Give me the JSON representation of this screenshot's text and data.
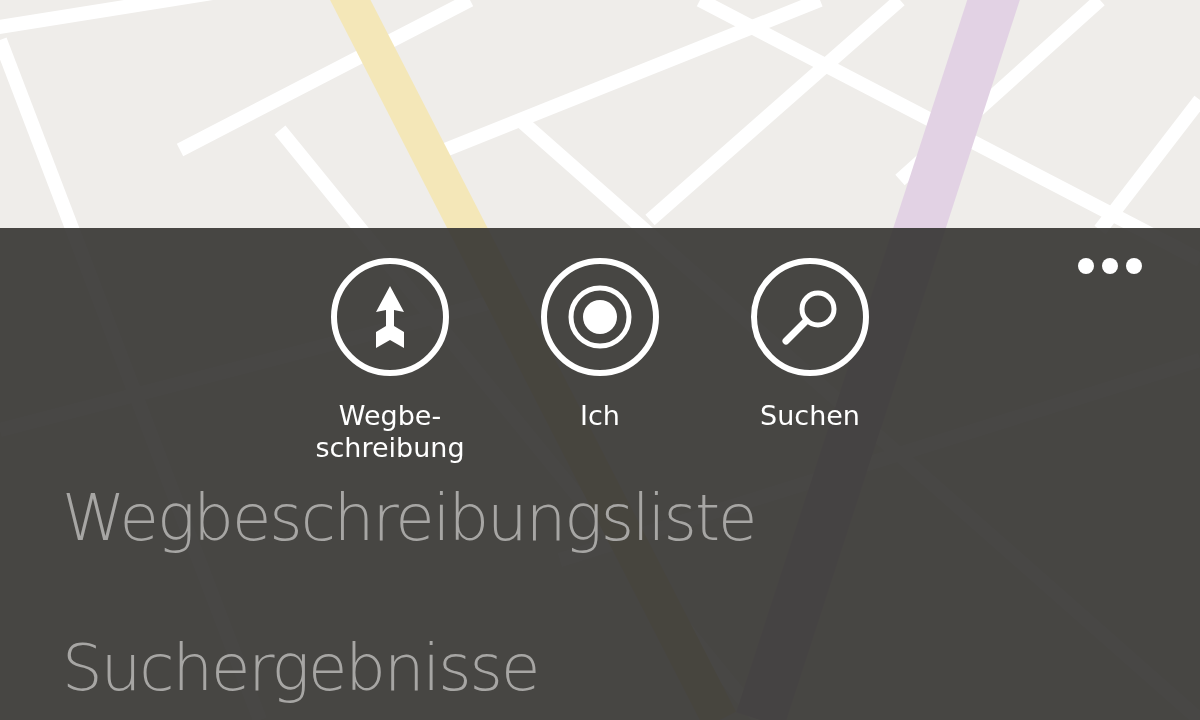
{
  "app_bar": {
    "buttons": [
      {
        "label": "Wegbe-\nschreibung",
        "kind": "directions"
      },
      {
        "label": "Ich",
        "kind": "me"
      },
      {
        "label": "Suchen",
        "kind": "search"
      }
    ]
  },
  "menu": {
    "items": [
      "Wegbeschreibungsliste",
      "Suchergebnisse"
    ]
  }
}
